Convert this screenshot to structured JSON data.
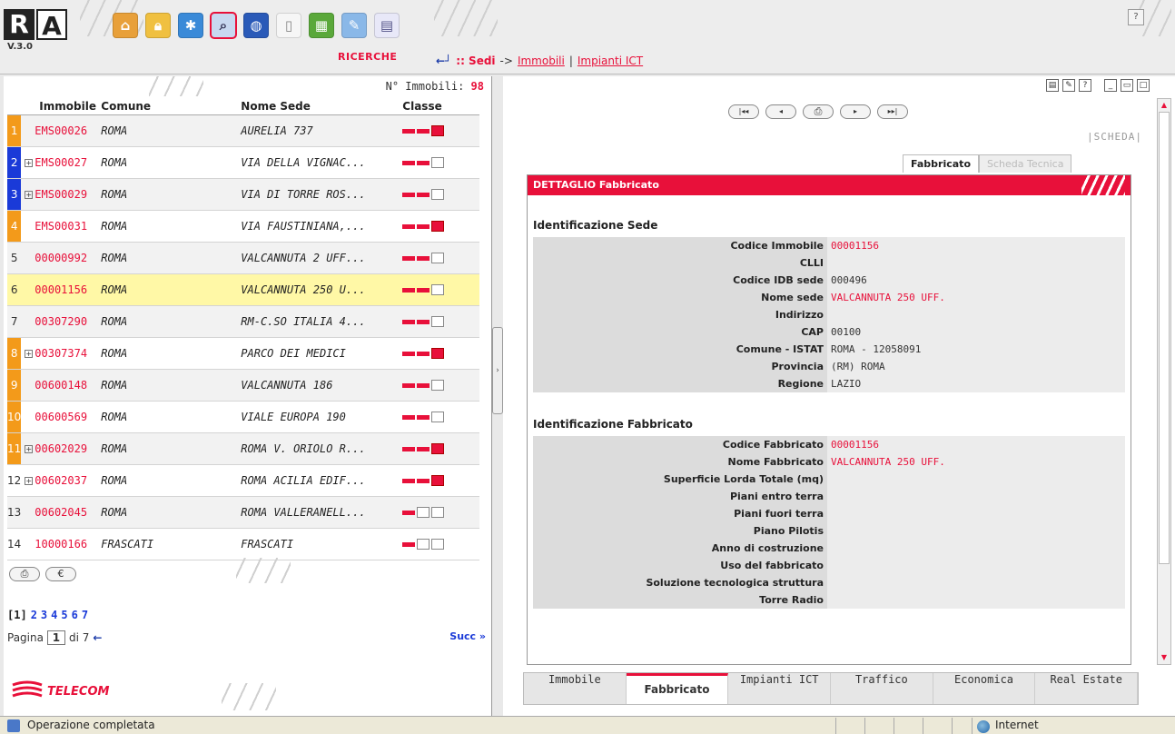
{
  "app": {
    "version": "V.3.0",
    "section_label": "RICERCHE",
    "help_label": "?"
  },
  "breadcrumb": {
    "current": ":: Sedi",
    "arrow": "->",
    "links": [
      "Immobili",
      "|",
      "Impianti ICT"
    ]
  },
  "left_panel": {
    "count_label": "N° Immobili:",
    "count_value": "98",
    "columns": [
      "Immobile",
      "Comune",
      "Nome Sede",
      "Classe"
    ],
    "rows": [
      {
        "n": "1",
        "badge": "orange",
        "plus": false,
        "code": "EMS00026",
        "comune": "ROMA",
        "sede": "AURELIA 737",
        "classe": "full"
      },
      {
        "n": "2",
        "badge": "blue",
        "plus": true,
        "code": "EMS00027",
        "comune": "ROMA",
        "sede": "VIA DELLA VIGNAC...",
        "classe": "two"
      },
      {
        "n": "3",
        "badge": "blue",
        "plus": true,
        "code": "EMS00029",
        "comune": "ROMA",
        "sede": "VIA DI TORRE ROS...",
        "classe": "two"
      },
      {
        "n": "4",
        "badge": "orange",
        "plus": false,
        "code": "EMS00031",
        "comune": "ROMA",
        "sede": "VIA FAUSTINIANA,...",
        "classe": "full"
      },
      {
        "n": "5",
        "badge": "none",
        "plus": false,
        "code": "00000992",
        "comune": "ROMA",
        "sede": "VALCANNUTA 2 UFF...",
        "classe": "two"
      },
      {
        "n": "6",
        "badge": "none",
        "plus": false,
        "code": "00001156",
        "comune": "ROMA",
        "sede": "VALCANNUTA 250 U...",
        "classe": "two",
        "selected": true
      },
      {
        "n": "7",
        "badge": "none",
        "plus": false,
        "code": "00307290",
        "comune": "ROMA",
        "sede": "RM-C.SO ITALIA 4...",
        "classe": "two"
      },
      {
        "n": "8",
        "badge": "orange",
        "plus": true,
        "code": "00307374",
        "comune": "ROMA",
        "sede": "PARCO DEI MEDICI",
        "classe": "full"
      },
      {
        "n": "9",
        "badge": "orange",
        "plus": false,
        "code": "00600148",
        "comune": "ROMA",
        "sede": "VALCANNUTA 186",
        "classe": "two"
      },
      {
        "n": "10",
        "badge": "orange",
        "plus": false,
        "code": "00600569",
        "comune": "ROMA",
        "sede": "VIALE EUROPA 190",
        "classe": "two"
      },
      {
        "n": "11",
        "badge": "orange",
        "plus": true,
        "code": "00602029",
        "comune": "ROMA",
        "sede": "ROMA V. ORIOLO R...",
        "classe": "full"
      },
      {
        "n": "12",
        "badge": "none",
        "plus": true,
        "code": "00602037",
        "comune": "ROMA",
        "sede": "ROMA ACILIA EDIF...",
        "classe": "full"
      },
      {
        "n": "13",
        "badge": "none",
        "plus": false,
        "code": "00602045",
        "comune": "ROMA",
        "sede": "ROMA VALLERANELL...",
        "classe": "one"
      },
      {
        "n": "14",
        "badge": "none",
        "plus": false,
        "code": "10000166",
        "comune": "FRASCATI",
        "sede": "FRASCATI",
        "classe": "one"
      }
    ],
    "pages": [
      "[1]",
      "2",
      "3",
      "4",
      "5",
      "6",
      "7"
    ],
    "pager_label": "Pagina",
    "pager_value": "1",
    "pager_of": "di 7",
    "next_label": "Succ »",
    "brand": "TELECOM"
  },
  "right_panel": {
    "scheda_label": "|SCHEDA|",
    "tabs": [
      "Fabbricato",
      "Scheda Tecnica"
    ],
    "header": "DETTAGLIO Fabbricato",
    "section1": {
      "title": "Identificazione Sede",
      "fields": [
        {
          "k": "Codice Immobile",
          "v": "00001156",
          "red": true
        },
        {
          "k": "CLLI",
          "v": ""
        },
        {
          "k": "Codice IDB sede",
          "v": "000496"
        },
        {
          "k": "Nome sede",
          "v": "VALCANNUTA 250 UFF.",
          "red": true
        },
        {
          "k": "Indirizzo",
          "v": ""
        },
        {
          "k": "CAP",
          "v": "00100"
        },
        {
          "k": "Comune - ISTAT",
          "v": "ROMA - 12058091"
        },
        {
          "k": "Provincia",
          "v": "(RM) ROMA"
        },
        {
          "k": "Regione",
          "v": "LAZIO"
        }
      ]
    },
    "section2": {
      "title": "Identificazione Fabbricato",
      "fields": [
        {
          "k": "Codice Fabbricato",
          "v": "00001156",
          "red": true
        },
        {
          "k": "Nome Fabbricato",
          "v": "VALCANNUTA 250 UFF.",
          "red": true
        },
        {
          "k": "Superficie Lorda Totale (mq)",
          "v": ""
        },
        {
          "k": "Piani entro terra",
          "v": ""
        },
        {
          "k": "Piani fuori terra",
          "v": ""
        },
        {
          "k": "Piano Pilotis",
          "v": ""
        },
        {
          "k": "Anno di costruzione",
          "v": ""
        },
        {
          "k": "Uso del fabbricato",
          "v": ""
        },
        {
          "k": "Soluzione tecnologica struttura",
          "v": ""
        },
        {
          "k": "Torre Radio",
          "v": ""
        }
      ]
    },
    "bottom_tabs": [
      "Immobile",
      "Fabbricato",
      "Impianti ICT",
      "Traffico",
      "Economica",
      "Real Estate"
    ],
    "active_bottom_tab": "Fabbricato"
  },
  "statusbar": {
    "message": "Operazione completata",
    "zone": "Internet"
  },
  "colors": {
    "accent": "#e8103a",
    "link": "#1a3ad8",
    "badge_orange": "#f39a1a",
    "badge_blue": "#1a3ad8",
    "selected_row": "#fff8a6"
  }
}
